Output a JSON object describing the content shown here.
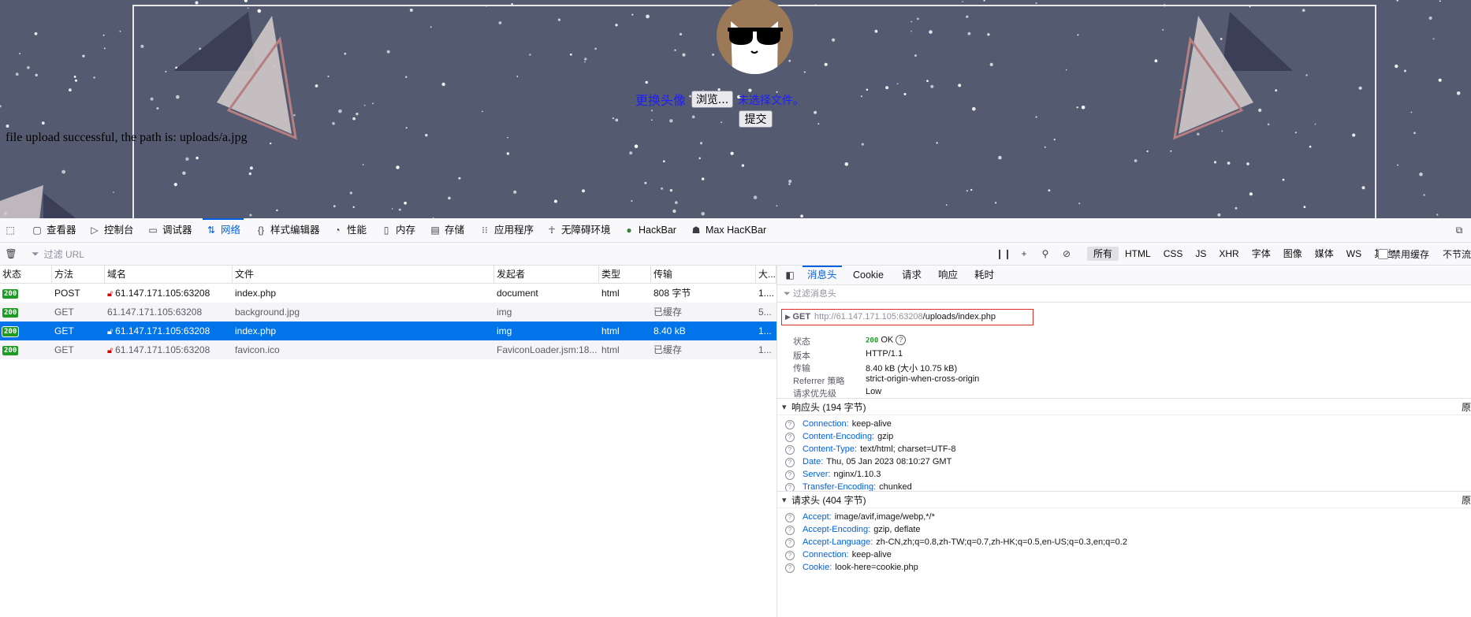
{
  "page": {
    "upload_label": "更换头像",
    "browse_button": "浏览...",
    "no_file_text": "未选择文件。",
    "submit_button": "提交",
    "success_message": "file upload successful, the path is: uploads/a.jpg"
  },
  "devtools": {
    "tabs": [
      {
        "label": "查看器",
        "icon": "inspector-icon"
      },
      {
        "label": "控制台",
        "icon": "console-icon"
      },
      {
        "label": "调试器",
        "icon": "debugger-icon"
      },
      {
        "label": "网络",
        "icon": "network-icon",
        "active": true
      },
      {
        "label": "样式编辑器",
        "icon": "style-editor-icon"
      },
      {
        "label": "性能",
        "icon": "performance-icon"
      },
      {
        "label": "内存",
        "icon": "memory-icon"
      },
      {
        "label": "存储",
        "icon": "storage-icon"
      },
      {
        "label": "应用程序",
        "icon": "application-icon"
      },
      {
        "label": "无障碍环境",
        "icon": "accessibility-icon"
      },
      {
        "label": "HackBar",
        "icon": "hackbar-icon"
      },
      {
        "label": "Max HacKBar",
        "icon": "max-hackbar-icon"
      }
    ],
    "toolbar": {
      "filter_placeholder": "过滤 URL",
      "type_filters": [
        "所有",
        "HTML",
        "CSS",
        "JS",
        "XHR",
        "字体",
        "图像",
        "媒体",
        "WS",
        "其他"
      ],
      "active_type_filter": "所有",
      "disable_cache": "禁用缓存",
      "throttling": "不节流"
    },
    "columns": [
      "状态",
      "方法",
      "域名",
      "文件",
      "发起者",
      "类型",
      "传输",
      "大..."
    ],
    "requests": [
      {
        "status": "200",
        "method": "POST",
        "domain": "61.147.171.105:63208",
        "file": "index.php",
        "initiator": "document",
        "type": "html",
        "transferred": "808 字节",
        "size": "1...."
      },
      {
        "status": "200",
        "method": "GET",
        "domain": "61.147.171.105:63208",
        "file": "background.jpg",
        "initiator": "img",
        "type": "",
        "transferred": "已缓存",
        "size": "5..."
      },
      {
        "status": "200",
        "method": "GET",
        "domain": "61.147.171.105:63208",
        "file": "index.php",
        "initiator": "img",
        "type": "html",
        "transferred": "8.40 kB",
        "size": "1...",
        "selected": true
      },
      {
        "status": "200",
        "method": "GET",
        "domain": "61.147.171.105:63208",
        "file": "favicon.ico",
        "initiator": "FaviconLoader.jsm:18...",
        "type": "html",
        "transferred": "已缓存",
        "size": "1..."
      }
    ],
    "details": {
      "tabs": [
        "消息头",
        "Cookie",
        "请求",
        "响应",
        "耗时"
      ],
      "active_tab": "消息头",
      "filter_placeholder": "过滤消息头",
      "request_method": "GET",
      "request_url_host": "http://61.147.171.105:63208",
      "request_url_path": "/uploads/index.php",
      "summary": [
        {
          "key": "状态",
          "value": "OK",
          "code": "200"
        },
        {
          "key": "版本",
          "value": "HTTP/1.1"
        },
        {
          "key": "传输",
          "value": "8.40 kB (大小 10.75 kB)"
        },
        {
          "key": "Referrer 策略",
          "value": "strict-origin-when-cross-origin"
        },
        {
          "key": "请求优先级",
          "value": "Low"
        }
      ],
      "response_headers_title": "响应头 (194 字节)",
      "response_headers": [
        {
          "key": "Connection:",
          "value": "keep-alive"
        },
        {
          "key": "Content-Encoding:",
          "value": "gzip"
        },
        {
          "key": "Content-Type:",
          "value": "text/html; charset=UTF-8"
        },
        {
          "key": "Date:",
          "value": "Thu, 05 Jan 2023 08:10:27 GMT"
        },
        {
          "key": "Server:",
          "value": "nginx/1.10.3"
        },
        {
          "key": "Transfer-Encoding:",
          "value": "chunked"
        }
      ],
      "request_headers_title": "请求头 (404 字节)",
      "request_headers": [
        {
          "key": "Accept:",
          "value": "image/avif,image/webp,*/*"
        },
        {
          "key": "Accept-Encoding:",
          "value": "gzip, deflate"
        },
        {
          "key": "Accept-Language:",
          "value": "zh-CN,zh;q=0.8,zh-TW;q=0.7,zh-HK;q=0.5,en-US;q=0.3,en;q=0.2"
        },
        {
          "key": "Connection:",
          "value": "keep-alive"
        },
        {
          "key": "Cookie:",
          "value": "look-here=cookie.php"
        }
      ],
      "raw_label": "原"
    }
  },
  "colors": {
    "page_bg": "#545a70",
    "accent": "#0061e0",
    "selected_row": "#0074e8",
    "status_ok": "#1e9b22",
    "highlight_box": "#d93025"
  }
}
